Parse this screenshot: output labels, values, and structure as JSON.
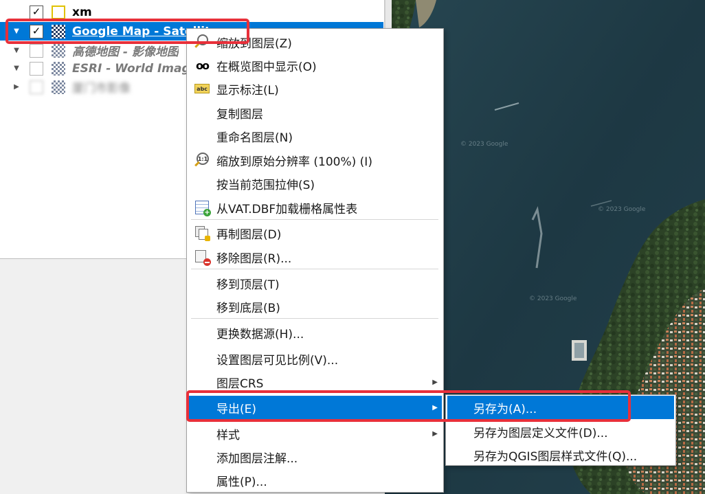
{
  "layers": {
    "items": [
      {
        "name": "xm",
        "checked": true,
        "icon": "polygon-icon",
        "style": "bold",
        "expandable": false
      },
      {
        "name": "Google Map - Satellite",
        "checked": true,
        "icon": "raster-icon",
        "style": "selected",
        "expandable": true
      },
      {
        "name": "高德地图 - 影像地图",
        "checked": false,
        "icon": "raster-icon",
        "style": "italic",
        "expandable": true
      },
      {
        "name": "ESRI - World Imagery",
        "checked": false,
        "icon": "raster-icon",
        "style": "italic",
        "expandable": true
      },
      {
        "name": "厦门市影像",
        "checked": false,
        "icon": "raster-icon",
        "style": "blurred",
        "expandable": false
      }
    ]
  },
  "context_menu": {
    "items": [
      {
        "label": "缩放到图层(Z)",
        "icon": "zoom-to-layer-icon"
      },
      {
        "label": "在概览图中显示(O)",
        "icon": "overview-glasses-icon"
      },
      {
        "label": "显示标注(L)",
        "icon": "abc-label-icon"
      },
      {
        "label": "复制图层",
        "icon": ""
      },
      {
        "label": "重命名图层(N)",
        "icon": ""
      },
      {
        "label": "缩放到原始分辨率 (100%) (I)",
        "icon": "zoom-native-resolution-icon"
      },
      {
        "label": "按当前范围拉伸(S)",
        "icon": ""
      },
      {
        "label": "从VAT.DBF加载栅格属性表",
        "icon": "attribute-table-icon"
      },
      {
        "label": "再制图层(D)",
        "icon": "duplicate-layer-icon"
      },
      {
        "label": "移除图层(R)...",
        "icon": "remove-layer-icon"
      },
      {
        "label": "移到顶层(T)",
        "icon": ""
      },
      {
        "label": "移到底层(B)",
        "icon": ""
      },
      {
        "label": "更换数据源(H)...",
        "icon": ""
      },
      {
        "label": "设置图层可见比例(V)...",
        "icon": ""
      },
      {
        "label": "图层CRS",
        "icon": "",
        "submenu": true
      },
      {
        "label": "导出(E)",
        "icon": "",
        "submenu": true,
        "highlighted": true
      },
      {
        "label": "样式",
        "icon": "",
        "submenu": true
      },
      {
        "label": "添加图层注解...",
        "icon": ""
      },
      {
        "label": "属性(P)...",
        "icon": ""
      }
    ]
  },
  "export_submenu": {
    "items": [
      {
        "label": "另存为(A)...",
        "highlighted": true
      },
      {
        "label": "另存为图层定义文件(D)..."
      },
      {
        "label": "另存为QGIS图层样式文件(Q)..."
      }
    ]
  },
  "colors": {
    "highlight": "#0078d7",
    "annotation": "#e8303a"
  }
}
